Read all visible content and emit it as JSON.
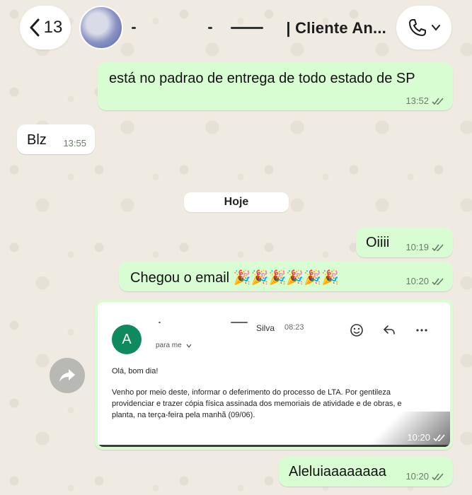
{
  "header": {
    "back_count": "13",
    "contact_name": "| Cliente An..."
  },
  "messages": [
    {
      "text": "está no padrao de entrega de todo estado de SP",
      "time": "13:52"
    },
    {
      "text": "Blz",
      "time": "13:55"
    },
    {
      "text": "Oiiii",
      "time": "10:19"
    },
    {
      "text": "Chegou o email 🎉🎉🎉🎉🎉🎉",
      "time": "10:20"
    },
    {
      "text": "Aleluiaaaaaaaa",
      "time": "10:20"
    }
  ],
  "day_separator": "Hoje",
  "email_image": {
    "avatar_letter": "A",
    "sender": "Silva",
    "sent_time": "08:23",
    "to": "para me",
    "greeting": "Olá, bom dia!",
    "body": "Venho por meio deste, informar o deferimento do processo de LTA. Por gentileza providenciar e trazer cópia física assinada dos memoriais de atividade e de obras, e planta, na terça-feira pela manhã (09/06).",
    "time": "10:20"
  },
  "colors": {
    "outgoing_bubble": "#d9fdd3",
    "incoming_bubble": "#ffffff",
    "email_avatar": "#0f8a5f"
  },
  "icons": [
    "chevron-left-icon",
    "phone-icon",
    "chevron-down-icon",
    "forward-icon",
    "emoji-icon",
    "reply-icon",
    "more-icon",
    "double-check-icon"
  ]
}
